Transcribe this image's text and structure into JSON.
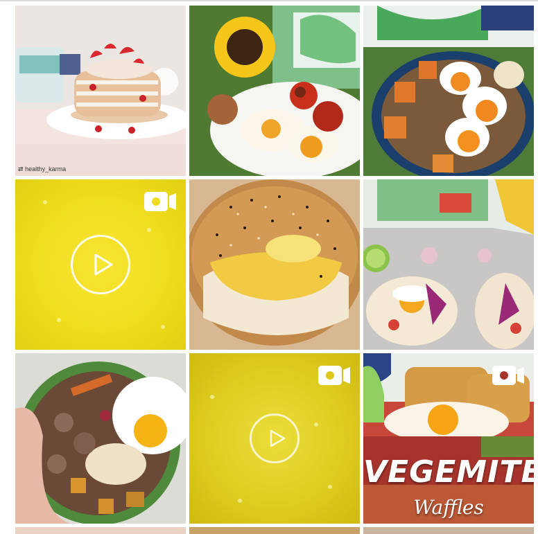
{
  "posts": [
    {
      "type": "photo",
      "description_icon": "photo",
      "attribution": "healthy_karma"
    },
    {
      "type": "photo",
      "description_icon": "photo"
    },
    {
      "type": "photo",
      "description_icon": "photo"
    },
    {
      "type": "video",
      "description_icon": "video-camera-icon"
    },
    {
      "type": "photo",
      "description_icon": "photo"
    },
    {
      "type": "photo",
      "description_icon": "photo"
    },
    {
      "type": "photo",
      "description_icon": "photo"
    },
    {
      "type": "video",
      "description_icon": "video-camera-icon"
    },
    {
      "type": "video",
      "description_icon": "video-camera-icon",
      "overlay_title": "VEGEMITE",
      "overlay_subtitle": "Waffles"
    }
  ],
  "colors": {
    "video_yellow": "#eedc1c",
    "video_yellow_alt": "#dcc91c"
  }
}
